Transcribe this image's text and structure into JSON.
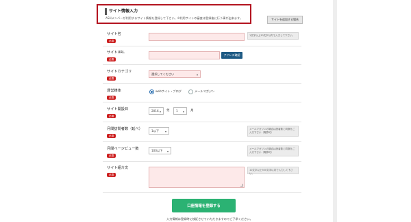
{
  "section": {
    "title": "サイト情報入力",
    "description": "ASHメンバーが利用するサイト情報を登録して下さい。※利用サイトの審査は登録後に行う事が出来ます。",
    "howto_button": "サイトを追加する場合"
  },
  "fields": {
    "site_name": {
      "label": "サイト名",
      "required": "必須",
      "value": "",
      "help": "1文字以上30文字以内で入力して下さい。"
    },
    "site_url": {
      "label": "サイトURL",
      "required": "必須",
      "value": "",
      "button": "アドレス確認"
    },
    "category": {
      "label": "サイトカテゴリ",
      "required": "必須",
      "selected": "選択してください"
    },
    "media": {
      "label": "運営媒体",
      "required": "必須",
      "option_web": "webサイト・ブログ",
      "option_mail": "メールマガジン"
    },
    "open_date": {
      "label": "サイト開設日",
      "required": "必須",
      "year": "2016",
      "year_unit": "年",
      "month": "1",
      "month_unit": "月"
    },
    "monthly_visits": {
      "label": "月間訪問者数（延べ）",
      "required": "必須",
      "selected": "1以下",
      "help": "メールマガジンの場合は読者数と同数をご入力下さい（概算可）"
    },
    "monthly_pv": {
      "label": "月間ページビュー数",
      "required": "必須",
      "selected": "100以下",
      "help": "メールマガジンの場合は読者数と同数をご入力下さい（概算可）"
    },
    "intro": {
      "label": "サイト紹介文",
      "required": "必須",
      "value": "",
      "help": "10文字以上500文字以内で入力して下さい。"
    }
  },
  "submit": {
    "label": "口座情報を登録する",
    "note": "入力情報は登録時に検証させていただきますのでご了承ください。"
  },
  "colors": {
    "header_border": "#b3131f",
    "required_badge": "#cc1f1f",
    "input_bg": "#fde9e9",
    "submit_bg": "#2bb273",
    "address_button_bg": "#1e5a84"
  }
}
